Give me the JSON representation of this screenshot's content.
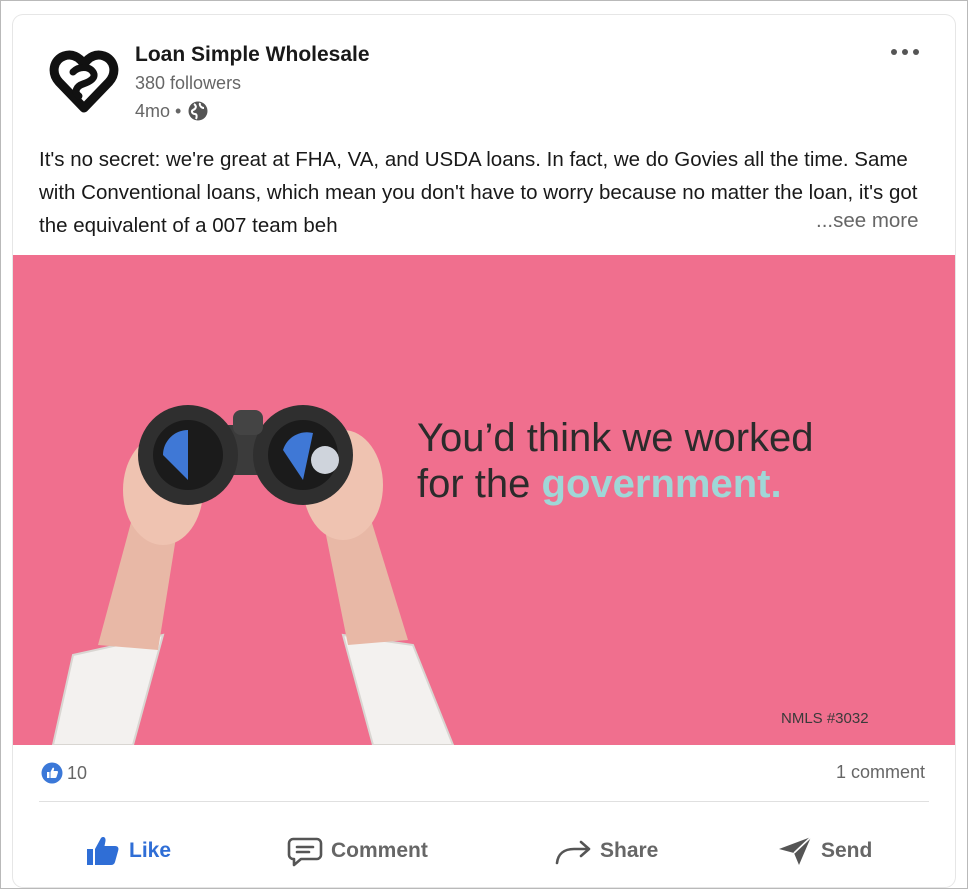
{
  "post": {
    "author": {
      "name": "Loan Simple Wholesale",
      "followers": "380 followers",
      "age": "4mo •",
      "logo_icon": "loan-simple-heart-logo",
      "visibility_icon": "globe-icon"
    },
    "text": "It's no secret: we're great at FHA, VA, and USDA loans. In fact, we do Govies all the time. Same with Conventional loans, which mean you don't have to worry because no matter the loan, it's got the equivalent of a 007 team beh",
    "see_more": "...see more",
    "image": {
      "headline_line1": "You’d think we worked",
      "headline_line2_prefix": "for the",
      "headline_line2_accent": "government.",
      "nmls": "NMLS #3032",
      "background_color": "#f06f8e",
      "accent_color": "#9fd7d7"
    },
    "stats": {
      "reaction_count": "10",
      "comments": "1 comment"
    },
    "actions": {
      "like": "Like",
      "comment": "Comment",
      "share": "Share",
      "send": "Send"
    }
  }
}
